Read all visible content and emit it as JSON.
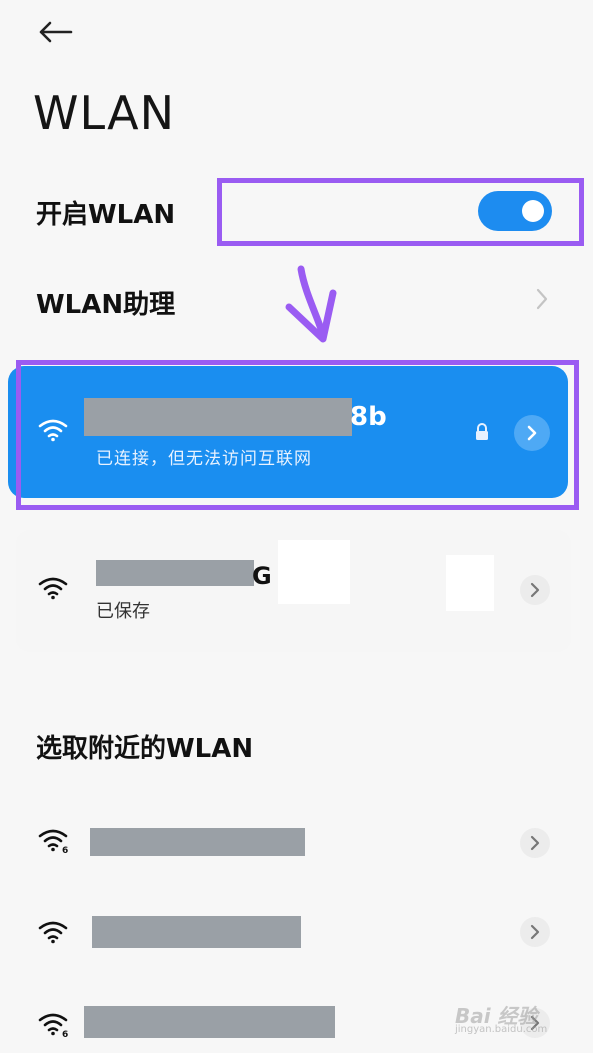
{
  "header": {
    "title": "WLAN",
    "back_icon": "arrow-left-icon"
  },
  "settings": {
    "toggle_label": "开启WLAN",
    "toggle_on": true,
    "assistant_label": "WLAN助理"
  },
  "connected_network": {
    "ssid_visible_suffix": "8b",
    "status": "已连接，但无法访问互联网",
    "secured": true
  },
  "saved_network": {
    "ssid_visible_suffix": "G",
    "status": "已保存"
  },
  "nearby": {
    "section_title": "选取附近的WLAN",
    "networks": [
      {
        "icon": "wifi-6-icon"
      },
      {
        "icon": "wifi-icon"
      },
      {
        "icon": "wifi-6-icon"
      }
    ]
  },
  "watermark": {
    "text": "Bai 经验",
    "sub": "jingyan.baidu.com"
  },
  "colors": {
    "accent": "#1a8ef0",
    "highlight": "#9a5cf2",
    "background": "#f7f7f7"
  }
}
